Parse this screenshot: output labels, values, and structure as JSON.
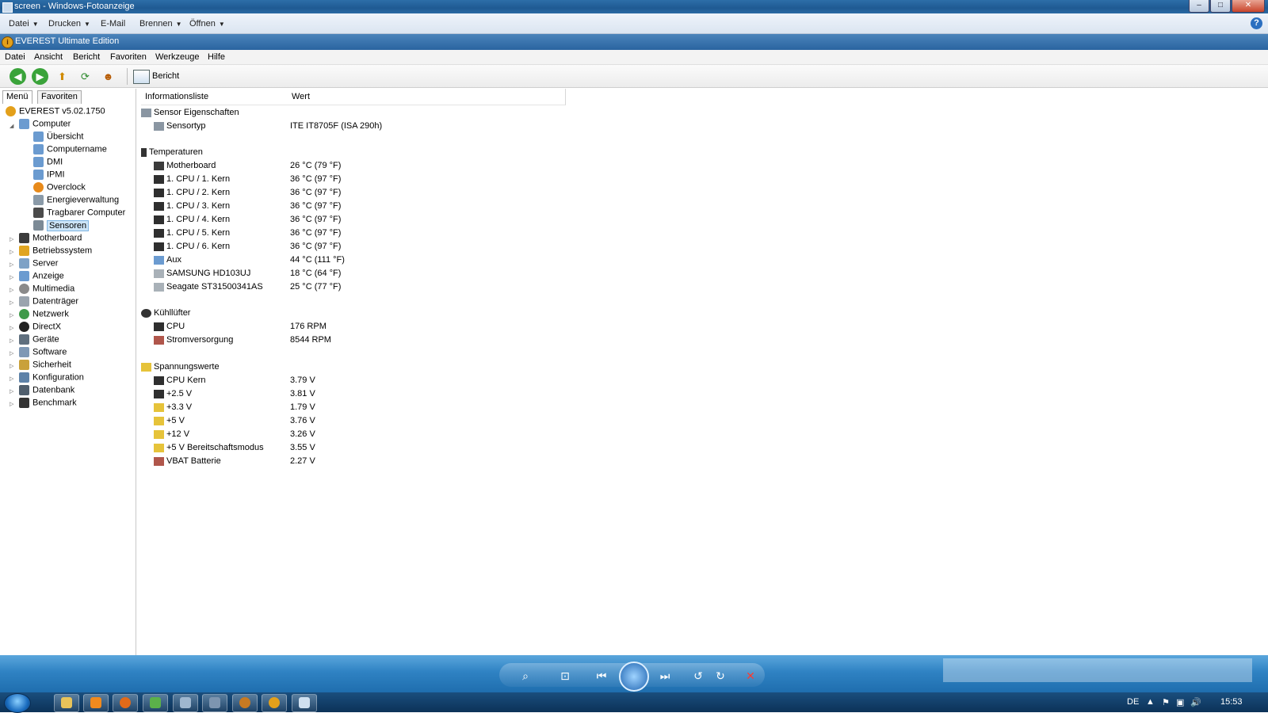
{
  "photo_viewer": {
    "title": "screen - Windows-Fotoanzeige",
    "menu": [
      "Datei",
      "Drucken",
      "E-Mail",
      "Brennen",
      "Öffnen"
    ],
    "help": "?"
  },
  "everest": {
    "title": "EVEREST Ultimate Edition",
    "menu": [
      "Datei",
      "Ansicht",
      "Bericht",
      "Favoriten",
      "Werkzeuge",
      "Hilfe"
    ],
    "toolbar_report": "Bericht",
    "tabs": [
      "Menü",
      "Favoriten"
    ],
    "tree": {
      "root": "EVEREST v5.02.1750",
      "computer": "Computer",
      "computer_children": [
        "Übersicht",
        "Computername",
        "DMI",
        "IPMI",
        "Overclock",
        "Energieverwaltung",
        "Tragbarer Computer",
        "Sensoren"
      ],
      "top_level": [
        "Motherboard",
        "Betriebssystem",
        "Server",
        "Anzeige",
        "Multimedia",
        "Datenträger",
        "Netzwerk",
        "DirectX",
        "Geräte",
        "Software",
        "Sicherheit",
        "Konfiguration",
        "Datenbank",
        "Benchmark"
      ],
      "selected": "Sensoren"
    },
    "columns": [
      "Informationsliste",
      "Wert"
    ],
    "groups": {
      "sensor": {
        "title": "Sensor Eigenschaften",
        "rows": [
          {
            "label": "Sensortyp",
            "value": "ITE IT8705F  (ISA 290h)"
          }
        ]
      },
      "temps": {
        "title": "Temperaturen",
        "rows": [
          {
            "label": "Motherboard",
            "value": "26 °C  (79 °F)"
          },
          {
            "label": "1. CPU / 1. Kern",
            "value": "36 °C  (97 °F)"
          },
          {
            "label": "1. CPU / 2. Kern",
            "value": "36 °C  (97 °F)"
          },
          {
            "label": "1. CPU / 3. Kern",
            "value": "36 °C  (97 °F)"
          },
          {
            "label": "1. CPU / 4. Kern",
            "value": "36 °C  (97 °F)"
          },
          {
            "label": "1. CPU / 5. Kern",
            "value": "36 °C  (97 °F)"
          },
          {
            "label": "1. CPU / 6. Kern",
            "value": "36 °C  (97 °F)"
          },
          {
            "label": "Aux",
            "value": "44 °C  (111 °F)"
          },
          {
            "label": "SAMSUNG HD103UJ",
            "value": "18 °C  (64 °F)"
          },
          {
            "label": "Seagate ST31500341AS",
            "value": "25 °C  (77 °F)"
          }
        ]
      },
      "fans": {
        "title": "Kühllüfter",
        "rows": [
          {
            "label": "CPU",
            "value": "176 RPM"
          },
          {
            "label": "Stromversorgung",
            "value": "8544 RPM"
          }
        ]
      },
      "volts": {
        "title": "Spannungswerte",
        "rows": [
          {
            "label": "CPU Kern",
            "value": "3.79 V"
          },
          {
            "label": "+2.5 V",
            "value": "3.81 V"
          },
          {
            "label": "+3.3 V",
            "value": "1.79 V"
          },
          {
            "label": "+5 V",
            "value": "3.76 V"
          },
          {
            "label": "+12 V",
            "value": "3.26 V"
          },
          {
            "label": "+5 V Bereitschaftsmodus",
            "value": "3.55 V"
          },
          {
            "label": "VBAT Batterie",
            "value": "2.27 V"
          }
        ]
      }
    }
  },
  "taskbar": {
    "language": "DE",
    "clock": "15:53"
  },
  "colors": {
    "title_blue": "#1f5a93",
    "taskbar": "#0c3258",
    "selection": "#cce4f7",
    "warning_yellow": "#e6c33a"
  }
}
